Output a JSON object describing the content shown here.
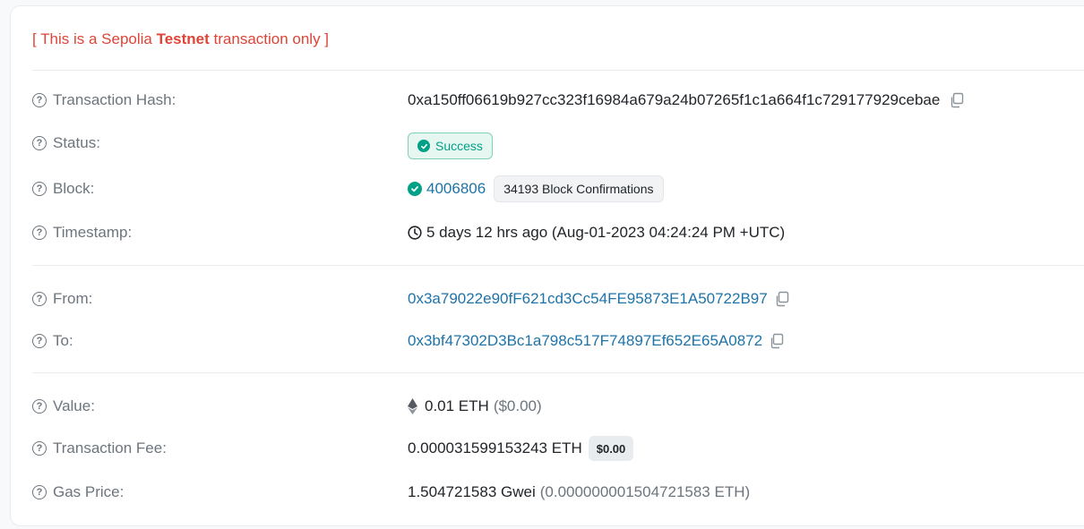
{
  "notice": {
    "prefix": "[ This is a Sepolia ",
    "bold": "Testnet",
    "suffix": " transaction only ]"
  },
  "fields": {
    "tx_hash": {
      "label": "Transaction Hash:",
      "value": "0xa150ff06619b927cc323f16984a679a24b07265f1c1a664f1c729177929cebae"
    },
    "status": {
      "label": "Status:",
      "value": "Success"
    },
    "block": {
      "label": "Block:",
      "number": "4006806",
      "confirmations": "34193 Block Confirmations"
    },
    "timestamp": {
      "label": "Timestamp:",
      "value": "5 days 12 hrs ago (Aug-01-2023 04:24:24 PM +UTC)"
    },
    "from": {
      "label": "From:",
      "value": "0x3a79022e90fF621cd3Cc54FE95873E1A50722B97"
    },
    "to": {
      "label": "To:",
      "value": "0x3bf47302D3Bc1a798c517F74897Ef652E65A0872"
    },
    "value": {
      "label": "Value:",
      "amount": "0.01 ETH",
      "usd": "($0.00)"
    },
    "fee": {
      "label": "Transaction Fee:",
      "amount": "0.000031599153243 ETH",
      "usd_badge": "$0.00"
    },
    "gas_price": {
      "label": "Gas Price:",
      "gwei": "1.504721583 Gwei",
      "eth": "(0.000000001504721583 ETH)"
    }
  },
  "colors": {
    "notice_red": "#de4437",
    "link_blue": "#1e73a8",
    "success_green": "#00a186"
  },
  "icons": [
    "question-circle-icon",
    "copy-icon",
    "check-circle-icon",
    "clock-icon",
    "ethereum-icon"
  ]
}
